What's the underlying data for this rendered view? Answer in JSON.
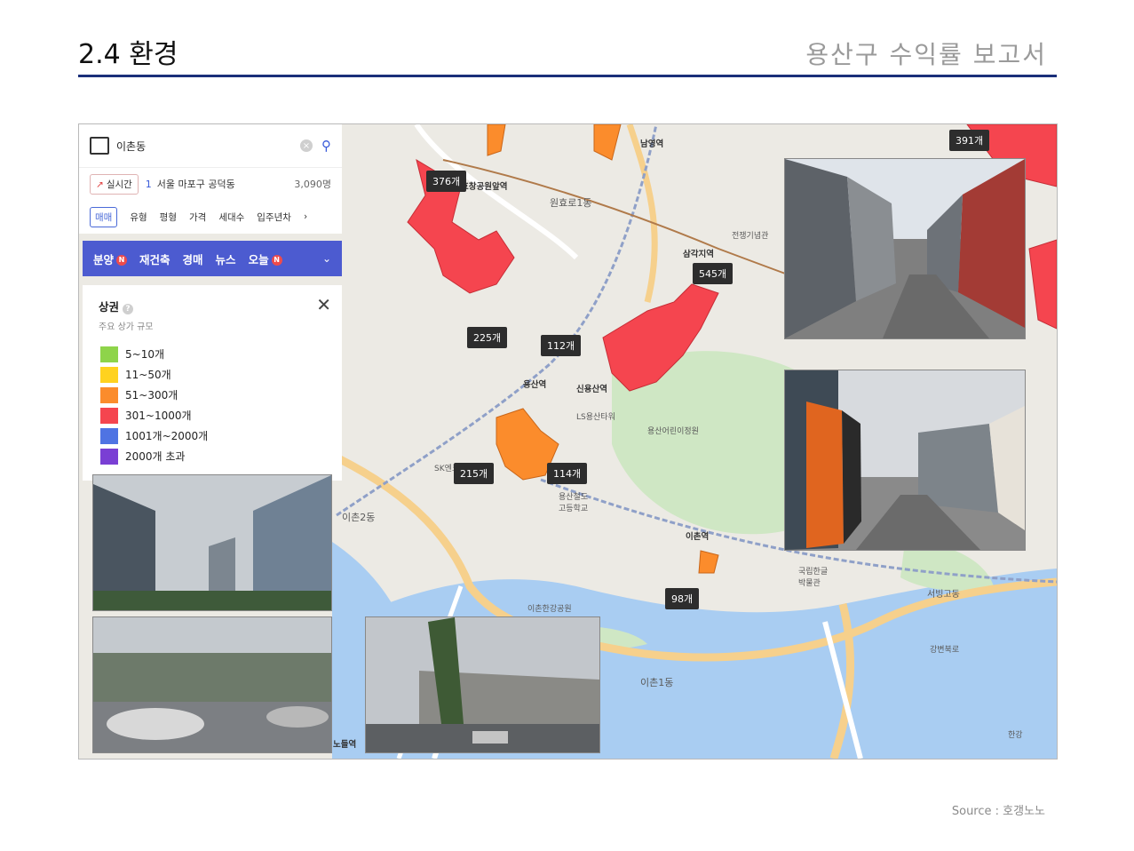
{
  "header": {
    "title": "2.4 환경",
    "subtitle": "용산구 수익률 보고서"
  },
  "search_panel": {
    "query": "이촌동",
    "live_label": "실시간",
    "trend_rank": "1",
    "trend_location": "서울 마포구 공덕동",
    "trend_count": "3,090명",
    "filters": [
      "매매",
      "유형",
      "평형",
      "가격",
      "세대수",
      "입주년차"
    ],
    "selected_filter": "매매",
    "categories": [
      "분양",
      "재건축",
      "경매",
      "뉴스",
      "오늘"
    ],
    "new_badge": "N"
  },
  "legend": {
    "title": "상권",
    "subtitle": "주요 상가 규모",
    "items": [
      {
        "label": "5~10개",
        "color": "#8ed44a"
      },
      {
        "label": "11~50개",
        "color": "#ffd21f"
      },
      {
        "label": "51~300개",
        "color": "#fb8c2c"
      },
      {
        "label": "301~1000개",
        "color": "#f5454f"
      },
      {
        "label": "1001개~2000개",
        "color": "#4f73e3"
      },
      {
        "label": "2000개 초과",
        "color": "#7a3fd4"
      }
    ]
  },
  "map_badges": [
    {
      "id": "376",
      "label": "376개"
    },
    {
      "id": "225",
      "label": "225개"
    },
    {
      "id": "112",
      "label": "112개"
    },
    {
      "id": "545",
      "label": "545개"
    },
    {
      "id": "391",
      "label": "391개"
    },
    {
      "id": "215",
      "label": "215개"
    },
    {
      "id": "114",
      "label": "114개"
    },
    {
      "id": "98",
      "label": "98개"
    }
  ],
  "map_labels": {
    "namyeong": "남영역",
    "hyochang": "효창공원앞역",
    "wonhyo": "원효로1동",
    "samgakji": "삼각지역",
    "yongsan": "용산역",
    "sinyongsan": "신용산역",
    "ichon": "이촌역",
    "ichon2": "이촌2동",
    "ichon1": "이촌1동",
    "seobinggo": "서빙고동",
    "memorial": "전쟁기념관",
    "hangang_park": "이촌한강공원",
    "museum": "국립한글박물관",
    "family_park": "용산어린이정원",
    "noduljeom": "노들역",
    "ganbyeon": "강변북로",
    "hangang": "한강",
    "sk": "SK엔크린",
    "yongsan_high": "용산철도고등학교",
    "ls": "LS용산타워"
  },
  "photos": {
    "p1_alt": "street-view-1",
    "p2_alt": "street-view-2"
  },
  "source": "Source : 호갱노노"
}
